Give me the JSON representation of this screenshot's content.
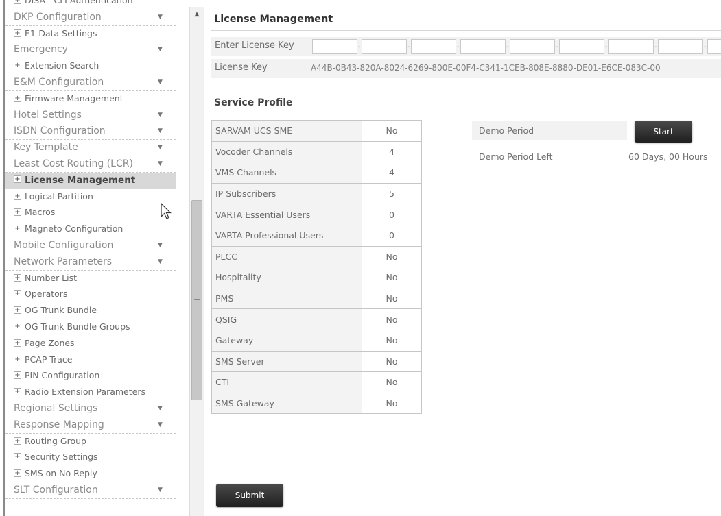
{
  "sidebar": {
    "items": [
      {
        "type": "sub",
        "label": "DISA - CLI Authentication"
      },
      {
        "type": "cat",
        "label": "DKP Configuration"
      },
      {
        "type": "sub",
        "label": "E1-Data Settings"
      },
      {
        "type": "cat",
        "label": "Emergency"
      },
      {
        "type": "sub",
        "label": "Extension Search"
      },
      {
        "type": "cat",
        "label": "E&M Configuration"
      },
      {
        "type": "sub",
        "label": "Firmware Management"
      },
      {
        "type": "cat",
        "label": "Hotel Settings"
      },
      {
        "type": "cat",
        "label": "ISDN Configuration"
      },
      {
        "type": "cat",
        "label": "Key Template"
      },
      {
        "type": "cat",
        "label": "Least Cost Routing (LCR)"
      },
      {
        "type": "sub",
        "label": "License Management",
        "active": true
      },
      {
        "type": "sub",
        "label": "Logical Partition"
      },
      {
        "type": "sub",
        "label": "Macros"
      },
      {
        "type": "sub",
        "label": "Magneto Configuration"
      },
      {
        "type": "cat",
        "label": "Mobile Configuration"
      },
      {
        "type": "cat",
        "label": "Network Parameters"
      },
      {
        "type": "sub",
        "label": "Number List"
      },
      {
        "type": "sub",
        "label": "Operators"
      },
      {
        "type": "sub",
        "label": "OG Trunk Bundle"
      },
      {
        "type": "sub",
        "label": "OG Trunk Bundle Groups"
      },
      {
        "type": "sub",
        "label": "Page Zones"
      },
      {
        "type": "sub",
        "label": "PCAP Trace"
      },
      {
        "type": "sub",
        "label": "PIN Configuration"
      },
      {
        "type": "sub",
        "label": "Radio Extension Parameters"
      },
      {
        "type": "cat",
        "label": "Regional Settings"
      },
      {
        "type": "cat",
        "label": "Response Mapping"
      },
      {
        "type": "sub",
        "label": "Routing Group"
      },
      {
        "type": "sub",
        "label": "Security Settings"
      },
      {
        "type": "sub",
        "label": "SMS on No Reply"
      },
      {
        "type": "cat",
        "label": "SLT Configuration"
      }
    ],
    "arrow_glyph": "▼",
    "plus_glyph": "+"
  },
  "main": {
    "title": "License Management",
    "enter_key_label": "Enter License Key",
    "enter_key_values": [
      "",
      "",
      "",
      "",
      "",
      "",
      "",
      "",
      ""
    ],
    "license_key_label": "License Key",
    "license_key_value": "A44B-0B43-820A-8024-6269-800E-00F4-C341-1CEB-808E-8880-DE01-E6CE-083C-00",
    "service_profile_title": "Service Profile",
    "service_profile": [
      {
        "name": "SARVAM UCS SME",
        "value": "No"
      },
      {
        "name": "Vocoder Channels",
        "value": "4"
      },
      {
        "name": "VMS Channels",
        "value": "4"
      },
      {
        "name": "IP Subscribers",
        "value": "5"
      },
      {
        "name": "VARTA Essential Users",
        "value": "0"
      },
      {
        "name": "VARTA Professional Users",
        "value": "0"
      },
      {
        "name": "PLCC",
        "value": "No"
      },
      {
        "name": "Hospitality",
        "value": "No"
      },
      {
        "name": "PMS",
        "value": "No"
      },
      {
        "name": "QSIG",
        "value": "No"
      },
      {
        "name": "Gateway",
        "value": "No"
      },
      {
        "name": "SMS Server",
        "value": "No"
      },
      {
        "name": "CTI",
        "value": "No"
      },
      {
        "name": "SMS Gateway",
        "value": "No"
      }
    ],
    "demo_period_label": "Demo Period",
    "start_button": "Start",
    "demo_period_left_label": "Demo Period Left",
    "demo_period_left_value": "60 Days,  00 Hours",
    "submit_button": "Submit"
  },
  "icons": {
    "cursor": "mouse-pointer-icon",
    "scroll_up": "▲"
  }
}
